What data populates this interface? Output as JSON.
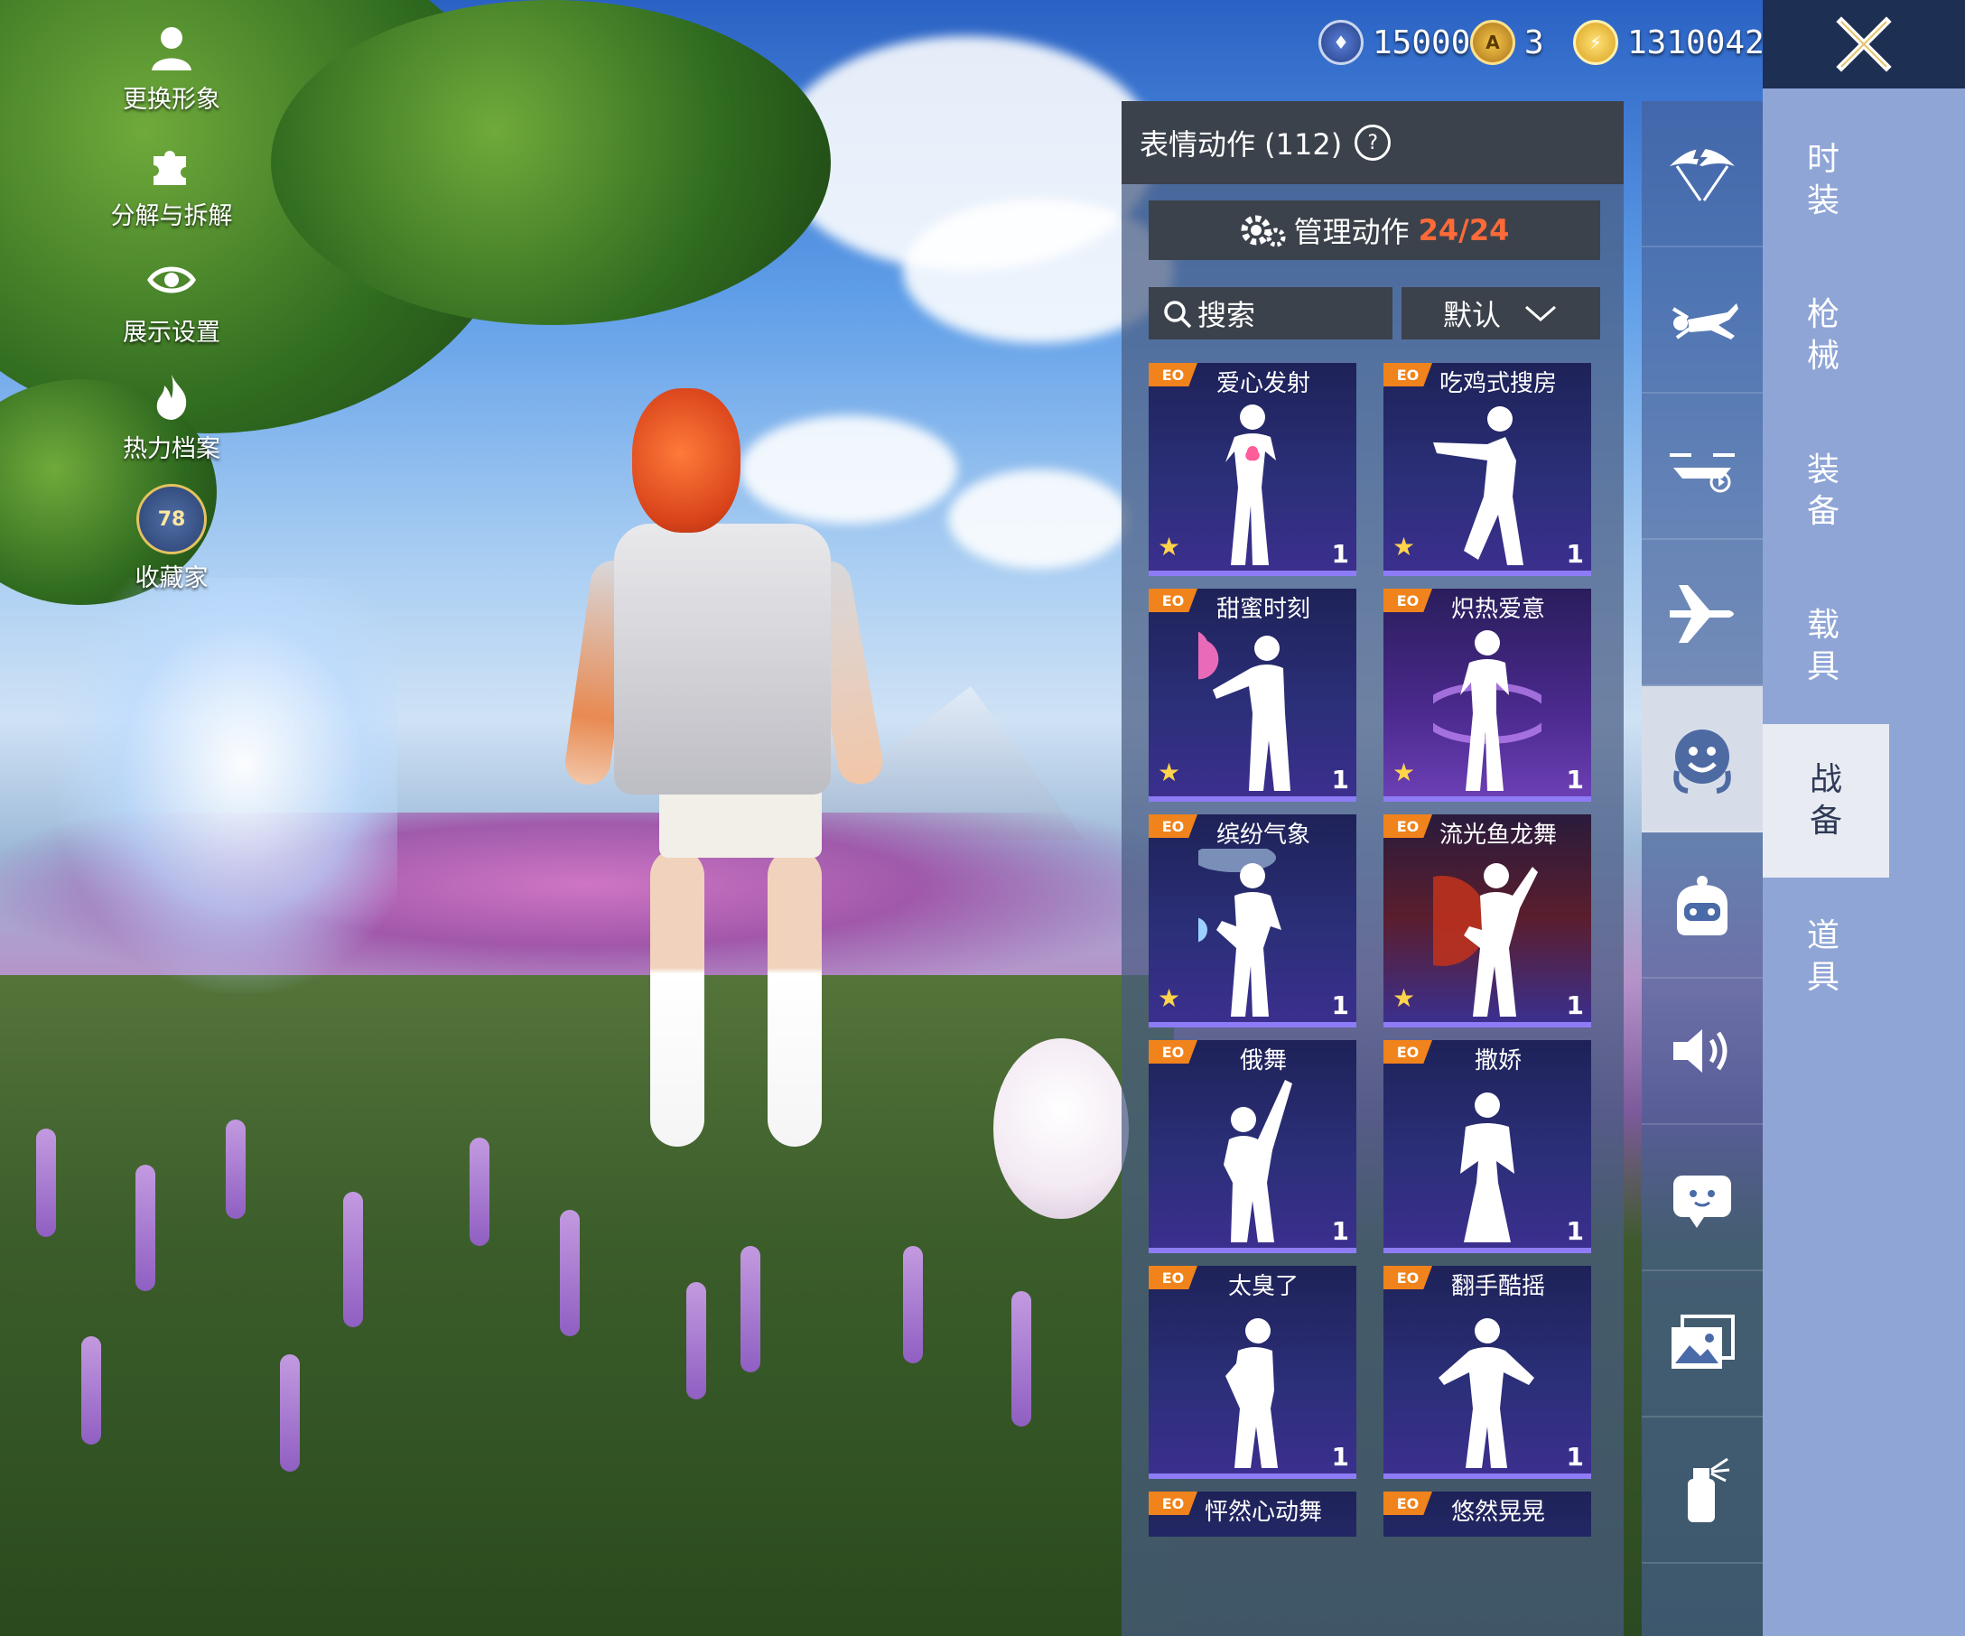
{
  "left_menu": [
    {
      "label": "更换形象",
      "icon": "avatar-icon"
    },
    {
      "label": "分解与拆解",
      "icon": "puzzle-icon"
    },
    {
      "label": "展示设置",
      "icon": "eye-icon"
    },
    {
      "label": "热力档案",
      "icon": "flame-icon"
    },
    {
      "label": "收藏家",
      "icon": "collector-badge-icon",
      "level": "78"
    }
  ],
  "currency": [
    {
      "icon": "bp-coin-icon",
      "value": "15000"
    },
    {
      "icon": "ag-coin-icon",
      "value": "3"
    },
    {
      "icon": "uc-coin-icon",
      "value": "1310042"
    }
  ],
  "panel": {
    "title": "表情动作 (112)",
    "manage_label": "管理动作",
    "manage_count": "24/24",
    "search_label": "搜索",
    "sort_label": "默认"
  },
  "emotes": [
    {
      "name": "爱心发射",
      "qty": "1",
      "tag": "EO"
    },
    {
      "name": "吃鸡式搜房",
      "qty": "1",
      "tag": "EO"
    },
    {
      "name": "甜蜜时刻",
      "qty": "1",
      "tag": "EO"
    },
    {
      "name": "炽热爱意",
      "qty": "1",
      "tag": "EO"
    },
    {
      "name": "缤纷气象",
      "qty": "1",
      "tag": "EO"
    },
    {
      "name": "流光鱼龙舞",
      "qty": "1",
      "tag": "EO"
    },
    {
      "name": "俄舞",
      "qty": "1",
      "tag": "EO"
    },
    {
      "name": "撒娇",
      "qty": "1",
      "tag": "EO"
    },
    {
      "name": "太臭了",
      "qty": "1",
      "tag": "EO"
    },
    {
      "name": "翻手酷摇",
      "qty": "1",
      "tag": "EO"
    },
    {
      "name": "怦然心动舞",
      "qty": "",
      "tag": "EO"
    },
    {
      "name": "悠然晃晃",
      "qty": "",
      "tag": "EO"
    }
  ],
  "categories": [
    {
      "icon": "parachute-icon"
    },
    {
      "icon": "skydive-icon"
    },
    {
      "icon": "drone-icon"
    },
    {
      "icon": "plane-icon"
    },
    {
      "icon": "emote-face-icon",
      "active": true
    },
    {
      "icon": "companion-icon"
    },
    {
      "icon": "speaker-icon"
    },
    {
      "icon": "chat-bubble-icon"
    },
    {
      "icon": "gallery-icon"
    },
    {
      "icon": "spray-icon"
    }
  ],
  "tabs": [
    {
      "label": "时装"
    },
    {
      "label": "枪械"
    },
    {
      "label": "装备"
    },
    {
      "label": "载具"
    },
    {
      "label": "战备",
      "active": true
    },
    {
      "label": "道具"
    }
  ],
  "colors": {
    "accent_count": "#ff6a38",
    "tag": "#f0831b",
    "card_border": "#8d7cf5"
  }
}
